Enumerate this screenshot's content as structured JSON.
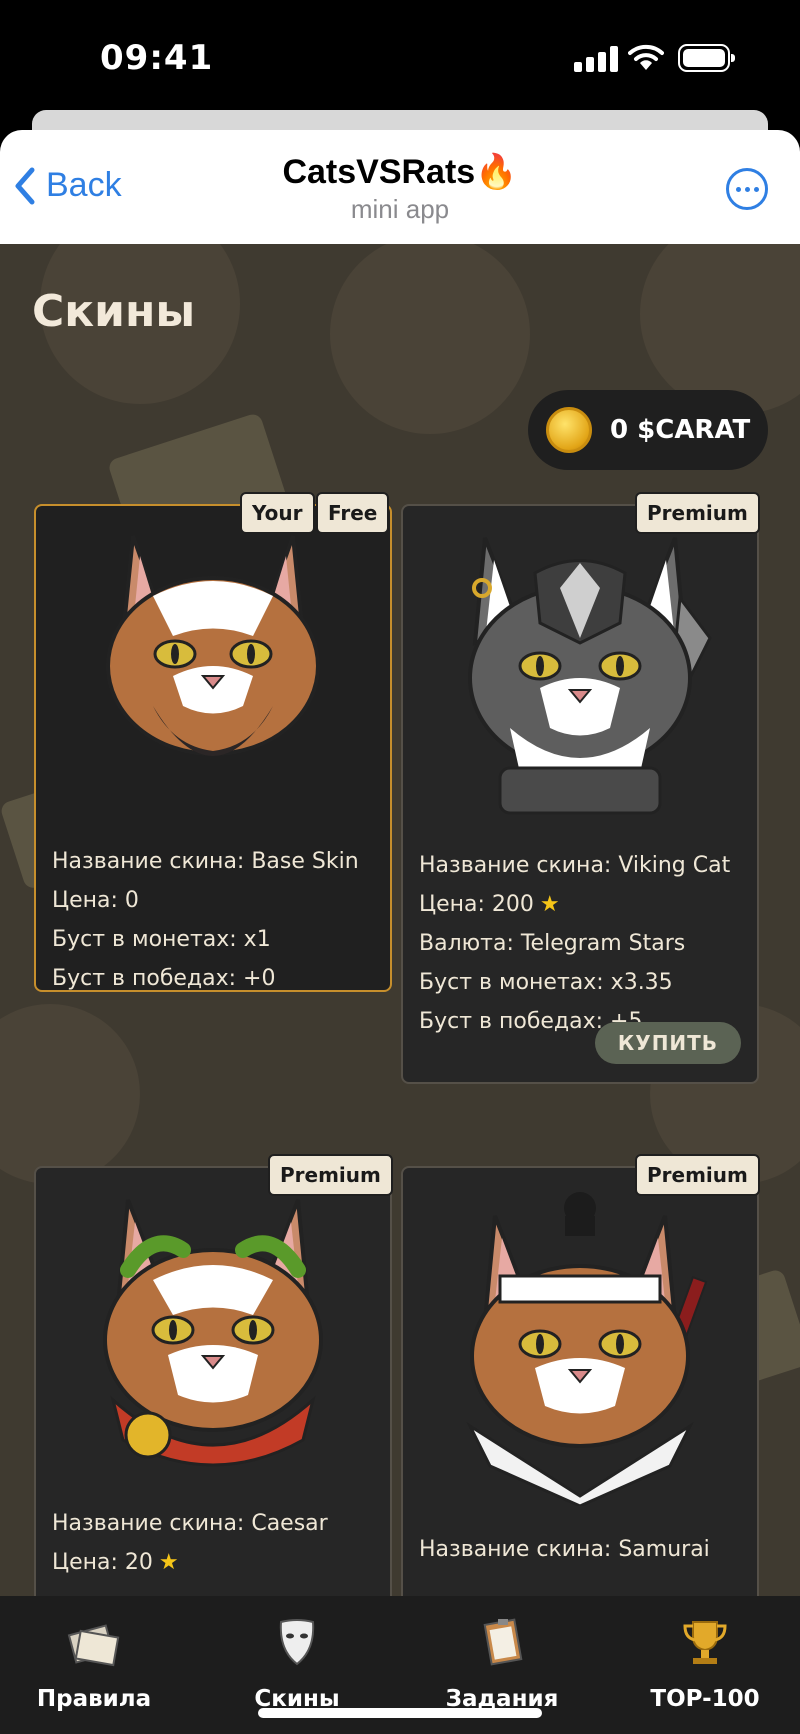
{
  "status_bar": {
    "time": "09:41"
  },
  "header": {
    "back_label": "Back",
    "title": "CatsVSRats🔥",
    "subtitle": "mini app"
  },
  "page": {
    "title": "Скины",
    "balance": "0 $CARAT"
  },
  "skins": [
    {
      "tags": [
        "Your",
        "Free"
      ],
      "name": "Название скина: Base Skin",
      "price": "Цена: 0",
      "coin_boost": "Буст в монетах: x1",
      "win_boost": "Буст в победах: +0"
    },
    {
      "tags": [
        "Premium"
      ],
      "name": "Название скина: Viking Cat",
      "price": "Цена: 200",
      "currency": "Валюта: Telegram Stars",
      "coin_boost": "Буст в монетах: x3.35",
      "win_boost": "Буст в победах: +5",
      "buy_label": "КУПИТЬ"
    },
    {
      "tags": [
        "Premium"
      ],
      "name": "Название скина: Caesar",
      "price": "Цена: 20"
    },
    {
      "tags": [
        "Premium"
      ],
      "name": "Название скина: Samurai"
    }
  ],
  "tabs": [
    {
      "label": "Правила",
      "icon": "rules-paper-icon"
    },
    {
      "label": "Скины",
      "icon": "mask-icon"
    },
    {
      "label": "Задания",
      "icon": "clipboard-icon"
    },
    {
      "label": "TOP-100",
      "icon": "trophy-icon"
    }
  ],
  "colors": {
    "accent_blue": "#2f7fe3",
    "active_card_border": "#c78f2c",
    "star": "#f5c518"
  }
}
